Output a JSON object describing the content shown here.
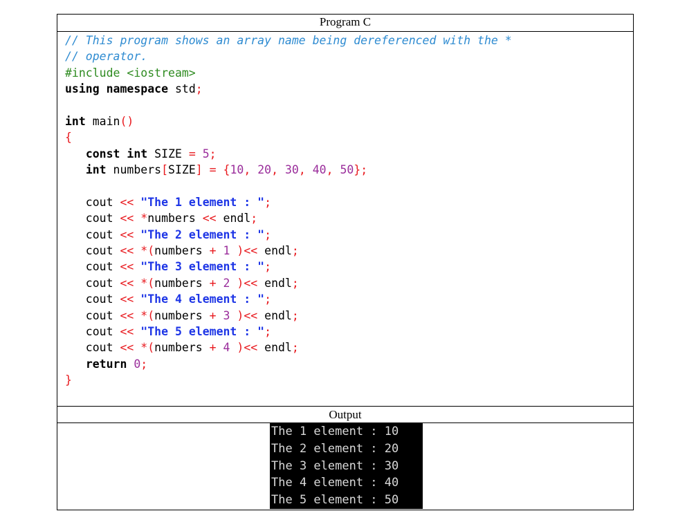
{
  "program_title": "Program C",
  "output_title": "Output",
  "code_lines": [
    [
      {
        "t": "cmt",
        "v": "// This program shows an array name being dereferenced with the *"
      }
    ],
    [
      {
        "t": "cmt",
        "v": "// operator."
      }
    ],
    [
      {
        "t": "pp",
        "v": "#include <iostream>"
      }
    ],
    [
      {
        "t": "kw",
        "v": "using"
      },
      {
        "t": "id",
        "v": " "
      },
      {
        "t": "kw",
        "v": "namespace"
      },
      {
        "t": "id",
        "v": " std"
      },
      {
        "t": "pun",
        "v": ";"
      }
    ],
    [],
    [
      {
        "t": "kw",
        "v": "int"
      },
      {
        "t": "id",
        "v": " main"
      },
      {
        "t": "pun",
        "v": "()"
      }
    ],
    [
      {
        "t": "brc",
        "v": "{"
      }
    ],
    [
      {
        "t": "id",
        "v": "   "
      },
      {
        "t": "kw",
        "v": "const"
      },
      {
        "t": "id",
        "v": " "
      },
      {
        "t": "kw",
        "v": "int"
      },
      {
        "t": "id",
        "v": " SIZE "
      },
      {
        "t": "pun",
        "v": "="
      },
      {
        "t": "id",
        "v": " "
      },
      {
        "t": "num",
        "v": "5"
      },
      {
        "t": "pun",
        "v": ";"
      }
    ],
    [
      {
        "t": "id",
        "v": "   "
      },
      {
        "t": "kw",
        "v": "int"
      },
      {
        "t": "id",
        "v": " numbers"
      },
      {
        "t": "pun",
        "v": "["
      },
      {
        "t": "id",
        "v": "SIZE"
      },
      {
        "t": "pun",
        "v": "]"
      },
      {
        "t": "id",
        "v": " "
      },
      {
        "t": "pun",
        "v": "="
      },
      {
        "t": "id",
        "v": " "
      },
      {
        "t": "pun",
        "v": "{"
      },
      {
        "t": "num",
        "v": "10"
      },
      {
        "t": "pun",
        "v": ","
      },
      {
        "t": "id",
        "v": " "
      },
      {
        "t": "num",
        "v": "20"
      },
      {
        "t": "pun",
        "v": ","
      },
      {
        "t": "id",
        "v": " "
      },
      {
        "t": "num",
        "v": "30"
      },
      {
        "t": "pun",
        "v": ","
      },
      {
        "t": "id",
        "v": " "
      },
      {
        "t": "num",
        "v": "40"
      },
      {
        "t": "pun",
        "v": ","
      },
      {
        "t": "id",
        "v": " "
      },
      {
        "t": "num",
        "v": "50"
      },
      {
        "t": "pun",
        "v": "};"
      }
    ],
    [],
    [
      {
        "t": "id",
        "v": "   cout "
      },
      {
        "t": "pun",
        "v": "<<"
      },
      {
        "t": "id",
        "v": " "
      },
      {
        "t": "str",
        "v": "\"The 1 element : \""
      },
      {
        "t": "pun",
        "v": ";"
      }
    ],
    [
      {
        "t": "id",
        "v": "   cout "
      },
      {
        "t": "pun",
        "v": "<<"
      },
      {
        "t": "id",
        "v": " "
      },
      {
        "t": "pun",
        "v": "*"
      },
      {
        "t": "id",
        "v": "numbers "
      },
      {
        "t": "pun",
        "v": "<<"
      },
      {
        "t": "id",
        "v": " endl"
      },
      {
        "t": "pun",
        "v": ";"
      }
    ],
    [
      {
        "t": "id",
        "v": "   cout "
      },
      {
        "t": "pun",
        "v": "<<"
      },
      {
        "t": "id",
        "v": " "
      },
      {
        "t": "str",
        "v": "\"The 2 element : \""
      },
      {
        "t": "pun",
        "v": ";"
      }
    ],
    [
      {
        "t": "id",
        "v": "   cout "
      },
      {
        "t": "pun",
        "v": "<<"
      },
      {
        "t": "id",
        "v": " "
      },
      {
        "t": "pun",
        "v": "*("
      },
      {
        "t": "id",
        "v": "numbers "
      },
      {
        "t": "pun",
        "v": "+"
      },
      {
        "t": "id",
        "v": " "
      },
      {
        "t": "num",
        "v": "1"
      },
      {
        "t": "id",
        "v": " "
      },
      {
        "t": "pun",
        "v": ")<<"
      },
      {
        "t": "id",
        "v": " endl"
      },
      {
        "t": "pun",
        "v": ";"
      }
    ],
    [
      {
        "t": "id",
        "v": "   cout "
      },
      {
        "t": "pun",
        "v": "<<"
      },
      {
        "t": "id",
        "v": " "
      },
      {
        "t": "str",
        "v": "\"The 3 element : \""
      },
      {
        "t": "pun",
        "v": ";"
      }
    ],
    [
      {
        "t": "id",
        "v": "   cout "
      },
      {
        "t": "pun",
        "v": "<<"
      },
      {
        "t": "id",
        "v": " "
      },
      {
        "t": "pun",
        "v": "*("
      },
      {
        "t": "id",
        "v": "numbers "
      },
      {
        "t": "pun",
        "v": "+"
      },
      {
        "t": "id",
        "v": " "
      },
      {
        "t": "num",
        "v": "2"
      },
      {
        "t": "id",
        "v": " "
      },
      {
        "t": "pun",
        "v": ")<<"
      },
      {
        "t": "id",
        "v": " endl"
      },
      {
        "t": "pun",
        "v": ";"
      }
    ],
    [
      {
        "t": "id",
        "v": "   cout "
      },
      {
        "t": "pun",
        "v": "<<"
      },
      {
        "t": "id",
        "v": " "
      },
      {
        "t": "str",
        "v": "\"The 4 element : \""
      },
      {
        "t": "pun",
        "v": ";"
      }
    ],
    [
      {
        "t": "id",
        "v": "   cout "
      },
      {
        "t": "pun",
        "v": "<<"
      },
      {
        "t": "id",
        "v": " "
      },
      {
        "t": "pun",
        "v": "*("
      },
      {
        "t": "id",
        "v": "numbers "
      },
      {
        "t": "pun",
        "v": "+"
      },
      {
        "t": "id",
        "v": " "
      },
      {
        "t": "num",
        "v": "3"
      },
      {
        "t": "id",
        "v": " "
      },
      {
        "t": "pun",
        "v": ")<<"
      },
      {
        "t": "id",
        "v": " endl"
      },
      {
        "t": "pun",
        "v": ";"
      }
    ],
    [
      {
        "t": "id",
        "v": "   cout "
      },
      {
        "t": "pun",
        "v": "<<"
      },
      {
        "t": "id",
        "v": " "
      },
      {
        "t": "str",
        "v": "\"The 5 element : \""
      },
      {
        "t": "pun",
        "v": ";"
      }
    ],
    [
      {
        "t": "id",
        "v": "   cout "
      },
      {
        "t": "pun",
        "v": "<<"
      },
      {
        "t": "id",
        "v": " "
      },
      {
        "t": "pun",
        "v": "*("
      },
      {
        "t": "id",
        "v": "numbers "
      },
      {
        "t": "pun",
        "v": "+"
      },
      {
        "t": "id",
        "v": " "
      },
      {
        "t": "num",
        "v": "4"
      },
      {
        "t": "id",
        "v": " "
      },
      {
        "t": "pun",
        "v": ")<<"
      },
      {
        "t": "id",
        "v": " endl"
      },
      {
        "t": "pun",
        "v": ";"
      }
    ],
    [
      {
        "t": "id",
        "v": "   "
      },
      {
        "t": "kw",
        "v": "return"
      },
      {
        "t": "id",
        "v": " "
      },
      {
        "t": "num",
        "v": "0"
      },
      {
        "t": "pun",
        "v": ";"
      }
    ],
    [
      {
        "t": "brc",
        "v": "}"
      }
    ]
  ],
  "console_lines": [
    "The 1 element : 10",
    "The 2 element : 20",
    "The 3 element : 30",
    "The 4 element : 40",
    "The 5 element : 50"
  ]
}
